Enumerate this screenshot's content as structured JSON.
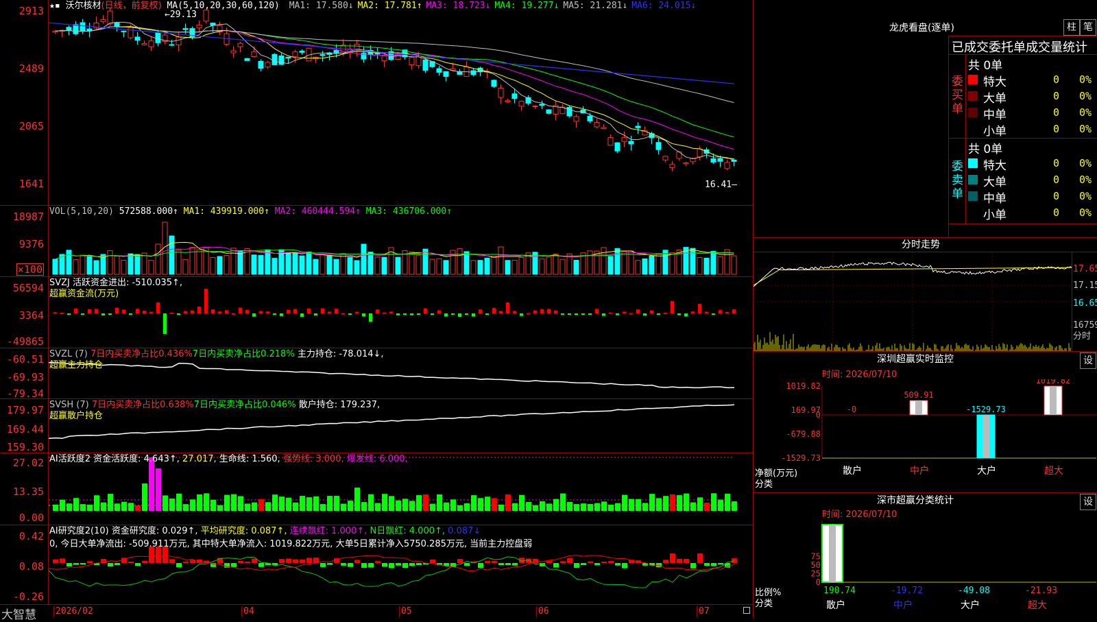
{
  "stock": {
    "name": "沃尔核材",
    "period": "(日线，前复权)",
    "ma_title": "MA(5,10,20,30,60,120)",
    "ma": [
      {
        "label": "MA1: 17.580↓",
        "color": "#c0c0c0"
      },
      {
        "label": "MA2: 17.781↑",
        "color": "#ffff00"
      },
      {
        "label": "MA3: 18.723↓",
        "color": "#ff00ff"
      },
      {
        "label": "MA4: 19.277↓",
        "color": "#00ff00"
      },
      {
        "label": "MA5: 21.281↓",
        "color": "#c0c0c0"
      },
      {
        "label": "MA6: 24.015↓",
        "color": "#3030ff"
      }
    ],
    "price_axis": [
      "2913",
      "2489",
      "2065",
      "1641"
    ],
    "high_label": "29.13",
    "low_label": "16.41"
  },
  "vol": {
    "title": "VOL(5,10,20)",
    "value": "572588.000↑",
    "ma1": "MA1: 439919.000↑",
    "ma2": "MA2: 460444.594↑",
    "ma3": "MA3: 436706.000↑",
    "axis": [
      "18987",
      "9376"
    ],
    "unit": "×100"
  },
  "svzj": {
    "title": "SVZJ  活跃资金进出: -510.035↑,",
    "sub": "超赢资金流(万元)",
    "axis": [
      "56594",
      "3364",
      "-49865"
    ]
  },
  "svzl": {
    "title": "SVZL (7)",
    "t1": "7日内买卖净占比0.436%",
    "t2": "7日内买卖净占比0.218%",
    "t3": "主力持仓: -78.014↓,",
    "sub": "超赢主力持仓",
    "axis": [
      "-60.51",
      "-69.93",
      "-79.34"
    ]
  },
  "svsh": {
    "title": "SVSH (7)",
    "t1": "7日内买卖净占比0.638%",
    "t2": "7日内买卖净占比0.046%",
    "t3": "散户持仓: 179.237,",
    "sub": "超赢散户持仓",
    "axis": [
      "179.97",
      "169.44",
      "159.30"
    ]
  },
  "ai1": {
    "title": "AI活跃度2 资金活跃度: 4.643↑,",
    "v2": "27.017,",
    "v3": "生命线: 1.560,",
    "v4": "强势线: 3.000,",
    "v5": "爆发线: 6.000,",
    "axis": [
      "27.02",
      "13.35",
      "0.00"
    ]
  },
  "ai2": {
    "title": "AI研究度2(10) 资金研究度: 0.029↑,",
    "v2": "平均研究度: 0.087↑,",
    "v3": "连续飘红: 1.000↑,",
    "v4": "N日飘红: 4.000↑,",
    "v5": "0.087↓",
    "desc": "0, 今日大单净流出: -509.911万元, 其中特大单净流入: 1019.822万元, 大单5日累计净入5750.285万元, 当前主力控盘弱",
    "axis": [
      "0.42",
      "0.08",
      "-0.26"
    ]
  },
  "xaxis": {
    "brand": "大智慧",
    "dates": [
      "2026/02",
      "04",
      "05",
      "06",
      "07"
    ]
  },
  "dragon": {
    "title": "龙虎看盘(逐单)",
    "btn1": "柱",
    "btn2": "笔",
    "header": "已成交委托单成交量统计",
    "buy": {
      "side": "委买单",
      "total": "共 0单",
      "rows": [
        {
          "label": "特大",
          "v": "0",
          "p": "0%",
          "color": "#ff0000"
        },
        {
          "label": "大单",
          "v": "0",
          "p": "0%",
          "color": "#800000"
        },
        {
          "label": "中单",
          "v": "0",
          "p": "0%",
          "color": "#600000"
        },
        {
          "label": "小单",
          "v": "0",
          "p": "0%",
          "color": "#000000"
        }
      ]
    },
    "sell": {
      "side": "委卖单",
      "total": "共 0单",
      "rows": [
        {
          "label": "特大",
          "v": "0",
          "p": "0%",
          "color": "#00ffff"
        },
        {
          "label": "大单",
          "v": "0",
          "p": "0%",
          "color": "#008080"
        },
        {
          "label": "中单",
          "v": "0",
          "p": "0%",
          "color": "#006060"
        },
        {
          "label": "小单",
          "v": "0",
          "p": "0%",
          "color": "#000000"
        }
      ]
    }
  },
  "intraday": {
    "title": "分时走势",
    "axis": [
      "17.65",
      "17.15",
      "16.65",
      "16759",
      "分时"
    ]
  },
  "sz_monitor": {
    "title": "深圳超赢实时监控",
    "btn": "设",
    "time": "时间: 2026/07/10",
    "axis": [
      "1019.82",
      "169.97",
      "0",
      "-679.88",
      "-1529.73"
    ],
    "ylabel": "净额(万元)",
    "xlabel": "分类",
    "chart_data": {
      "type": "bar",
      "categories": [
        "散户",
        "中户",
        "大户",
        "超大"
      ],
      "values": [
        0,
        509.91,
        -1529.73,
        1019.82
      ],
      "labels": [
        "-0",
        "509.91",
        "-1529.73",
        "1019.82"
      ],
      "ylim": [
        -1529.73,
        1019.82
      ]
    }
  },
  "sz_class": {
    "title": "深市超赢分类统计",
    "btn": "设",
    "time": "时间: 2026/07/10",
    "axis": [
      "75",
      "50",
      "25",
      "0"
    ],
    "ylabel": "比例%",
    "xlabel": "分类",
    "chart_data": {
      "type": "bar",
      "categories": [
        "散户",
        "中户",
        "大户",
        "超大"
      ],
      "values": [
        190.74,
        -19.72,
        -49.08,
        -21.93
      ],
      "ylim": [
        0,
        100
      ]
    }
  }
}
